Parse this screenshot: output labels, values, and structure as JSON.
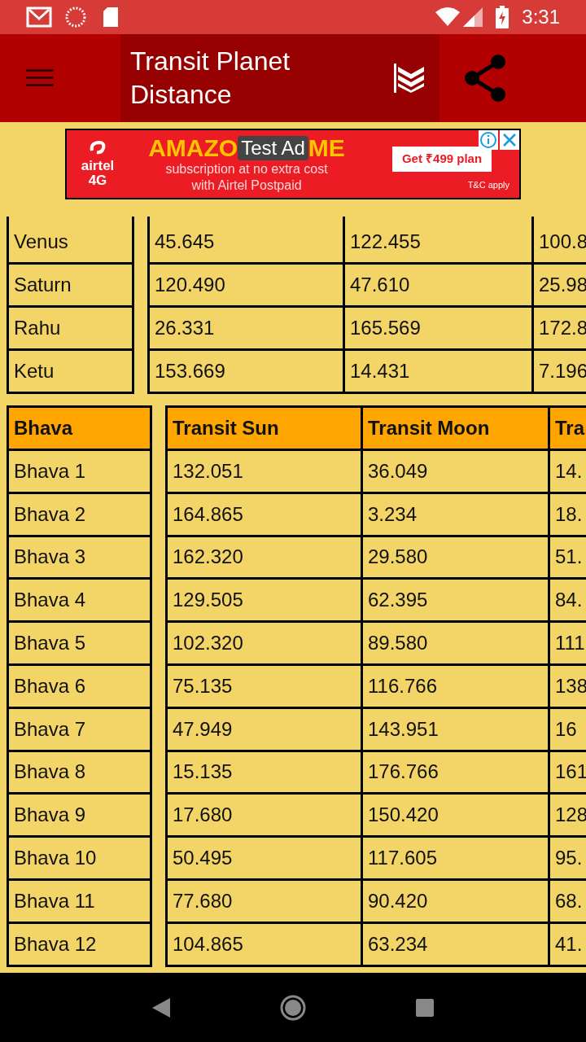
{
  "status_bar": {
    "time": "3:31"
  },
  "toolbar": {
    "title": "Transit Planet Distance"
  },
  "ad": {
    "label": "Test Ad",
    "brand": "airtel",
    "network": "4G",
    "headline_left": "AMAZO",
    "headline_right": "ME",
    "line_1": "subscription at no extra cost",
    "line_2": "with Airtel Postpaid",
    "offer": "Get ₹499 plan",
    "terms": "T&C apply"
  },
  "planet_table": {
    "rows": [
      {
        "name": "Venus",
        "values": [
          "45.645",
          "122.455",
          "100.8"
        ]
      },
      {
        "name": "Saturn",
        "values": [
          "120.490",
          "47.610",
          "25.98"
        ]
      },
      {
        "name": "Rahu",
        "values": [
          "26.331",
          "165.569",
          "172.8"
        ]
      },
      {
        "name": "Ketu",
        "values": [
          "153.669",
          "14.431",
          "7.196"
        ]
      }
    ]
  },
  "bhava_table": {
    "header": "Bhava",
    "columns": [
      "Transit Sun",
      "Transit Moon",
      "Tra"
    ],
    "rows": [
      {
        "name": "Bhava 1",
        "values": [
          "132.051",
          "36.049",
          "14."
        ]
      },
      {
        "name": "Bhava 2",
        "values": [
          "164.865",
          "3.234",
          "18."
        ]
      },
      {
        "name": "Bhava 3",
        "values": [
          "162.320",
          "29.580",
          "51."
        ]
      },
      {
        "name": "Bhava 4",
        "values": [
          "129.505",
          "62.395",
          "84."
        ]
      },
      {
        "name": "Bhava 5",
        "values": [
          "102.320",
          "89.580",
          "111"
        ]
      },
      {
        "name": "Bhava 6",
        "values": [
          "75.135",
          "116.766",
          "138"
        ]
      },
      {
        "name": "Bhava 7",
        "values": [
          "47.949",
          "143.951",
          "16"
        ]
      },
      {
        "name": "Bhava 8",
        "values": [
          "15.135",
          "176.766",
          "161"
        ]
      },
      {
        "name": "Bhava 9",
        "values": [
          "17.680",
          "150.420",
          "128"
        ]
      },
      {
        "name": "Bhava 10",
        "values": [
          "50.495",
          "117.605",
          "95."
        ]
      },
      {
        "name": "Bhava 11",
        "values": [
          "77.680",
          "90.420",
          "68."
        ]
      },
      {
        "name": "Bhava 12",
        "values": [
          "104.865",
          "63.234",
          "41."
        ]
      }
    ]
  }
}
